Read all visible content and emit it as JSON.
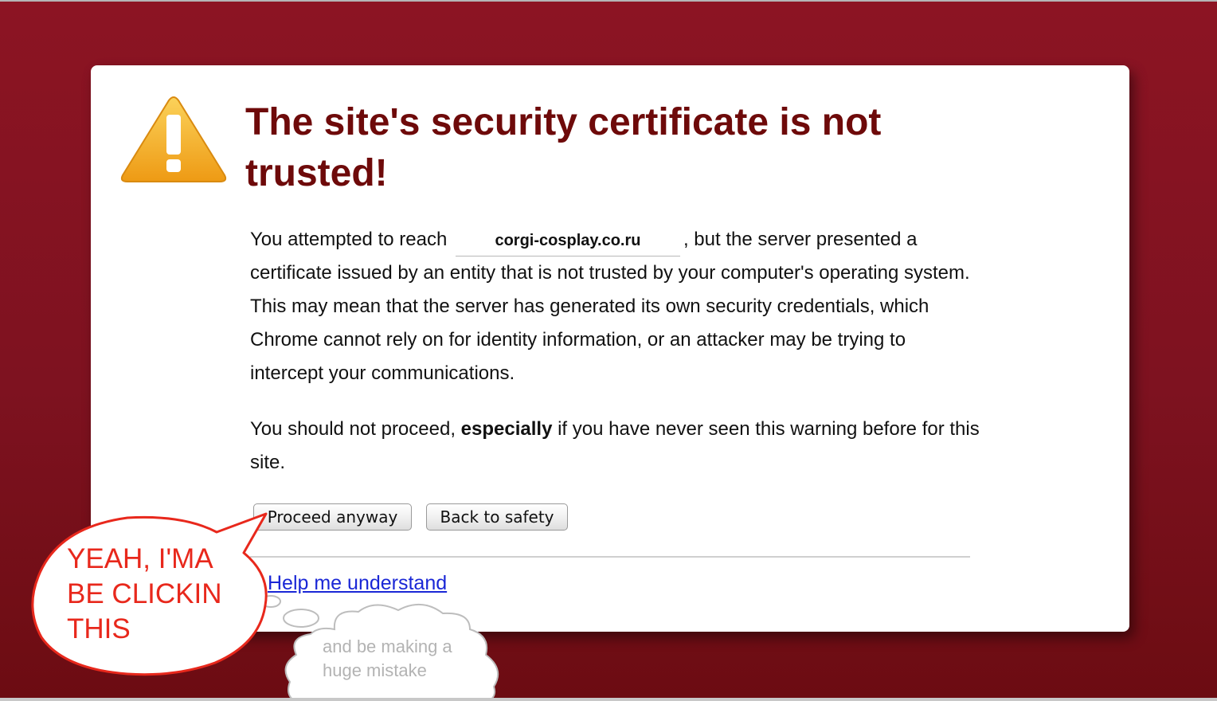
{
  "colors": {
    "background": "#831020",
    "card": "#ffffff",
    "title": "#6e0a0a",
    "link": "#1a27d6",
    "annotation_red": "#e8281c",
    "annotation_gray": "#b3b3b3",
    "warning_yellow": "#f2a81e"
  },
  "icons": {
    "warning": "warning-triangle-icon"
  },
  "page": {
    "title": "The site's security certificate is not trusted!",
    "paragraph1": {
      "before": "You attempted to reach",
      "host": "corgi-cosplay.co.ru",
      "after": ", but the server presented a certificate issued by an entity that is not trusted by your computer's operating system. This may mean that the server has generated its own security credentials, which Chrome cannot rely on for identity information, or an attacker may be trying to intercept your communications."
    },
    "paragraph2": {
      "before": "You should not proceed,",
      "emphasis": "especially",
      "after": "if you have never seen this warning before for this site."
    },
    "buttons": {
      "proceed": "Proceed anyway",
      "back": "Back to safety"
    },
    "help_link": "Help me understand"
  },
  "annotations": {
    "speech_bubble": [
      "YEAH, I'MA",
      "BE CLICKIN",
      "THIS"
    ],
    "thought_bubble": [
      "and be making a",
      "huge mistake"
    ]
  }
}
